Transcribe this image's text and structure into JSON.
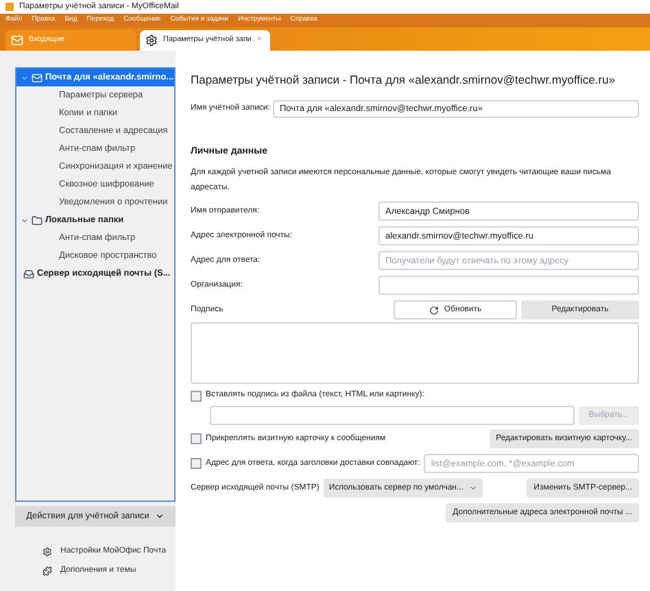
{
  "window": {
    "title": "Параметры учётной записи - MyOfficeMail"
  },
  "menu": [
    "Файл",
    "Правка",
    "Вид",
    "Переход",
    "Сообщение",
    "События и задачи",
    "Инструменты",
    "Справка"
  ],
  "tabs": [
    {
      "label": "Входящие",
      "selected": false,
      "kind": "mail"
    },
    {
      "label": "Параметры учётной запи",
      "selected": true,
      "kind": "settings",
      "close": "×"
    }
  ],
  "sidebar": {
    "tree": [
      {
        "label": "Почта для «alexandr.smirno...",
        "kind": "mail",
        "selected": true,
        "expanded": true,
        "children": [
          {
            "label": "Параметры сервера"
          },
          {
            "label": "Копии и папки"
          },
          {
            "label": "Составление и адресация"
          },
          {
            "label": "Анти-спам фильтр"
          },
          {
            "label": "Синхронизация и хранение"
          },
          {
            "label": "Сквозное шифрование"
          },
          {
            "label": "Уведомления о прочтении"
          }
        ]
      },
      {
        "label": "Локальные папки",
        "kind": "folder",
        "selected": false,
        "expanded": true,
        "children": [
          {
            "label": "Анти-спам фильтр"
          },
          {
            "label": "Дисковое пространство"
          }
        ]
      },
      {
        "label": "Сервер исходящей почты (S...",
        "kind": "outbox",
        "selected": false
      }
    ],
    "actions_button": "Действия для учётной записи",
    "links": [
      {
        "label": "Настройки МойОфис Почта",
        "kind": "gear"
      },
      {
        "label": "Дополнения и темы",
        "kind": "puzzle"
      }
    ]
  },
  "main": {
    "title": "Параметры учётной записи - Почта для «alexandr.smirnov@techwr.myoffice.ru»",
    "account_name": {
      "label": "Имя учётной записи:",
      "value": "Почта для «alexandr.smirnov@techwr.myoffice.ru»"
    },
    "section": "Личные данные",
    "description": "Для каждой учетной записи имеются персональные данные, которые смогут увидеть читающие ваши письма адресаты.",
    "fields": [
      {
        "label": "Имя отправителя:",
        "value": "Александр Смирнов"
      },
      {
        "label": "Адрес электронной почты:",
        "value": "alexandr.smirnov@techwr.myoffice.ru"
      },
      {
        "label": "Адрес для ответа:",
        "placeholder": "Получатели будут отвечать по этому адресу"
      },
      {
        "label": "Организация:"
      }
    ],
    "signature": {
      "label": "Подпись",
      "refresh": "Обновить",
      "edit": "Редактировать"
    },
    "signature_file": {
      "label": "Вставлять подпись из файла (текст, HTML или картинку):",
      "checked": false,
      "browse": "Выбрать..."
    },
    "vcard": {
      "label": "Прикреплять визитную карточку к сообщениям",
      "checked": false,
      "button": "Редактировать визитную карточку..."
    },
    "reply_to": {
      "label": "Адрес для ответа, когда заголовки доставки совпадают:",
      "checked": false,
      "placeholder": "list@example.com, *@example.com"
    },
    "smtp": {
      "label": "Сервер исходящей почты (SMTP)",
      "select": "Использовать сервер по умолчан...",
      "button": "Изменить SMTP-сервер..."
    },
    "more_addresses": "Дополнительные адреса электронной почты ..."
  }
}
